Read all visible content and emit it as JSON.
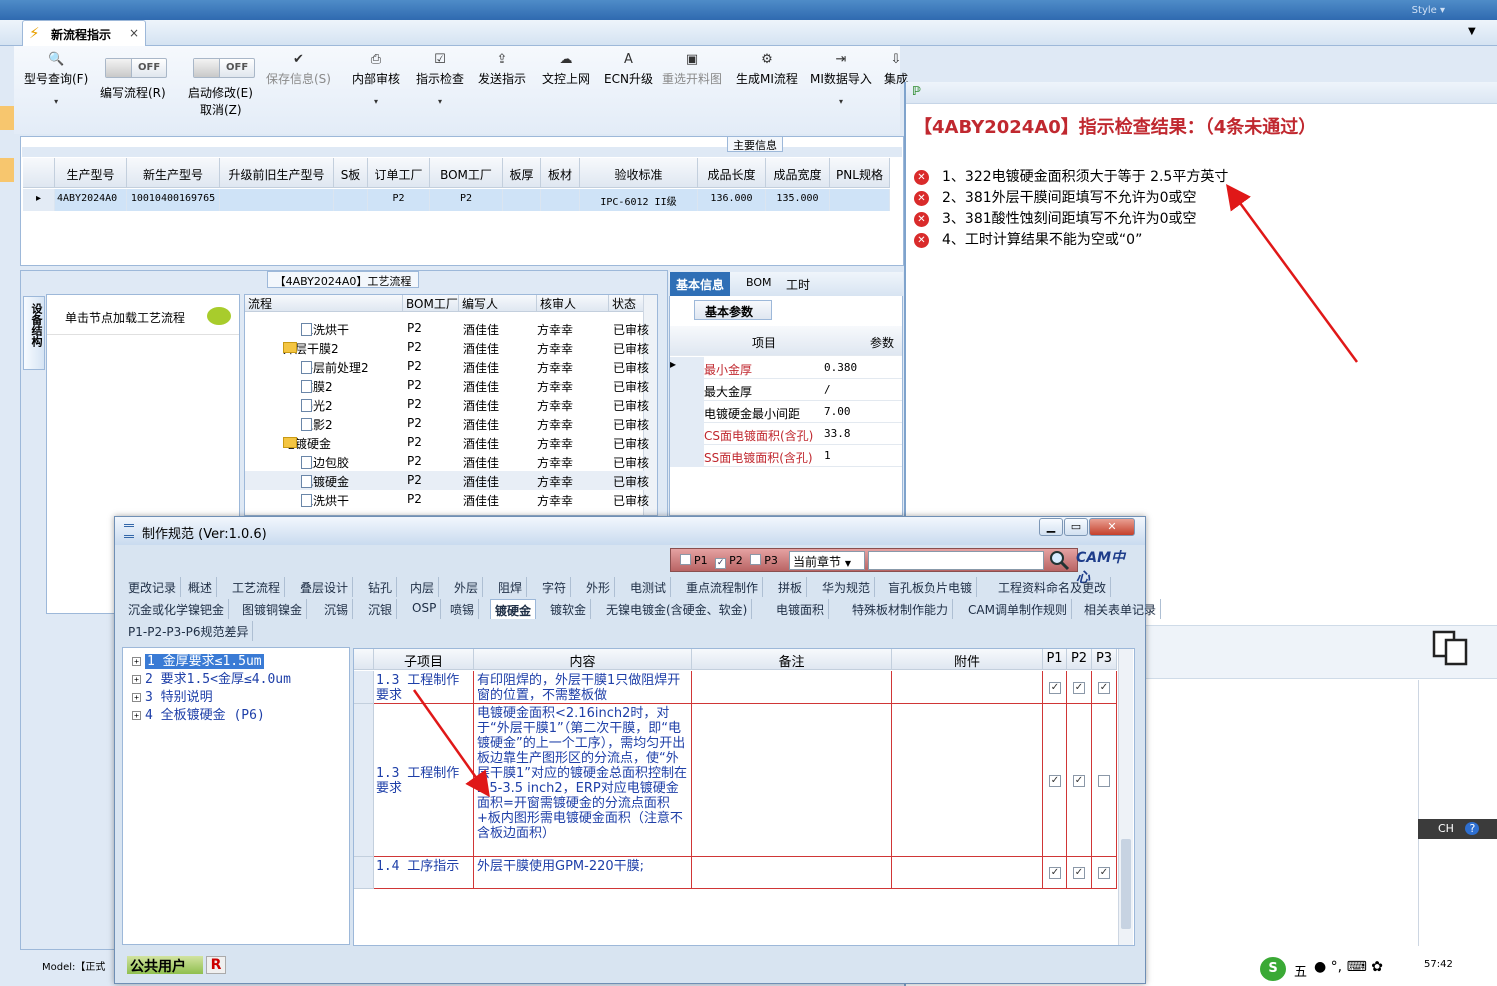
{
  "topbar": {
    "style_label": "Style ▾"
  },
  "tab": {
    "title": "新流程指示",
    "close": "×"
  },
  "ribbon": {
    "items": [
      {
        "label": "型号查询(F)",
        "icon": "search-icon",
        "sym": "🔍"
      },
      {
        "label": "保存信息(S)",
        "icon": "check-icon",
        "sym": "✔",
        "disabled": true
      },
      {
        "label": "内部审核",
        "icon": "printer-icon",
        "sym": "⎙"
      },
      {
        "label": "指示检查",
        "icon": "clipboard-check-icon",
        "sym": "☑"
      },
      {
        "label": "发送指示",
        "icon": "upload-icon",
        "sym": "⇪"
      },
      {
        "label": "文控上网",
        "icon": "cloud-icon",
        "sym": "☁"
      },
      {
        "label": "ECN升级",
        "icon": "ecn-icon",
        "sym": "A"
      },
      {
        "label": "重选开料图",
        "icon": "image-icon",
        "sym": "▣",
        "disabled": true
      },
      {
        "label": "生成MI流程",
        "icon": "gears-icon",
        "sym": "⚙"
      },
      {
        "label": "MI数据导入",
        "icon": "import-icon",
        "sym": "⇥"
      },
      {
        "label": "集成",
        "icon": "download-icon",
        "sym": "⇩"
      }
    ],
    "toggles": [
      {
        "state": "OFF",
        "label": "编写流程(R)"
      },
      {
        "state": "OFF",
        "label": "启动修改(E)",
        "sub": "取消(Z)"
      }
    ]
  },
  "main_info": {
    "title": "主要信息",
    "columns": [
      "生产型号",
      "新生产型号",
      "升级前旧生产型号",
      "S板",
      "订单工厂",
      "BOM工厂",
      "板厚",
      "板材",
      "验收标准",
      "成品长度",
      "成品宽度",
      "PNL规格"
    ],
    "row": [
      "4ABY2024A0",
      "10010400169765",
      "",
      "",
      "P2",
      "P2",
      "",
      "",
      "IPC-6012 II级",
      "136.000",
      "135.000",
      ""
    ]
  },
  "process": {
    "title": "【4ABY2024A0】工艺流程",
    "side_tab": "设备结构",
    "node_hint": "单击节点加载工艺流程",
    "columns": [
      "流程",
      "BOM工厂",
      "编写人",
      "核审人",
      "状态"
    ],
    "rows": [
      {
        "name": "水洗烘干",
        "type": "doc",
        "level": 2,
        "bom": "P2",
        "author": "酒佳佳",
        "reviewer": "方幸幸",
        "status": "已审核"
      },
      {
        "name": "外层干膜2",
        "type": "folder",
        "level": 1,
        "bom": "P2",
        "author": "酒佳佳",
        "reviewer": "方幸幸",
        "status": "已审核"
      },
      {
        "name": "外层前处理2",
        "type": "doc",
        "level": 2,
        "bom": "P2",
        "author": "酒佳佳",
        "reviewer": "方幸幸",
        "status": "已审核"
      },
      {
        "name": "贴膜2",
        "type": "doc",
        "level": 2,
        "bom": "P2",
        "author": "酒佳佳",
        "reviewer": "方幸幸",
        "status": "已审核"
      },
      {
        "name": "曝光2",
        "type": "doc",
        "level": 2,
        "bom": "P2",
        "author": "酒佳佳",
        "reviewer": "方幸幸",
        "status": "已审核"
      },
      {
        "name": "显影2",
        "type": "doc",
        "level": 2,
        "bom": "P2",
        "author": "酒佳佳",
        "reviewer": "方幸幸",
        "status": "已审核"
      },
      {
        "name": "电镀硬金",
        "type": "folder",
        "level": 1,
        "bom": "P2",
        "author": "酒佳佳",
        "reviewer": "方幸幸",
        "status": "已审核"
      },
      {
        "name": "板边包胶",
        "type": "doc",
        "level": 2,
        "bom": "P2",
        "author": "酒佳佳",
        "reviewer": "方幸幸",
        "status": "已审核"
      },
      {
        "name": "电镀硬金",
        "type": "doc",
        "level": 2,
        "bom": "P2",
        "author": "酒佳佳",
        "reviewer": "方幸幸",
        "status": "已审核"
      },
      {
        "name": "水洗烘干",
        "type": "doc",
        "level": 2,
        "bom": "P2",
        "author": "酒佳佳",
        "reviewer": "方幸幸",
        "status": "已审核"
      }
    ]
  },
  "basic": {
    "tabs": [
      "基本信息",
      "BOM",
      "工时"
    ],
    "sub_tab": "基本参数",
    "columns": [
      "项目",
      "参数"
    ],
    "rows": [
      {
        "key": "最小金厚",
        "value": "0.380",
        "red": true
      },
      {
        "key": "最大金厚",
        "value": "/",
        "red": false
      },
      {
        "key": "电镀硬金最小间距",
        "value": "7.00",
        "red": false
      },
      {
        "key": "CS面电镀面积(含孔)",
        "value": "33.8",
        "red": true
      },
      {
        "key": "SS面电镀面积(含孔)",
        "value": "1",
        "red": true
      }
    ]
  },
  "check_result": {
    "title": "【4ABY2024A0】指示检查结果：（4条未通过）",
    "items": [
      "1、322电镀硬金面积须大于等于 2.5平方英寸",
      "2、381外层干膜间距填写不允许为0或空",
      "3、381酸性蚀刻间距填写不允许为0或空",
      "4、工时计算结果不能为空或“0”"
    ]
  },
  "dialog": {
    "title": "制作规范 (Ver:1.0.6)",
    "filters": [
      "P1",
      "P2",
      "P3"
    ],
    "filter_checked": [
      false,
      true,
      false
    ],
    "chapter": "当前章节",
    "logo": "CAM中心",
    "tabs_row1": [
      "更改记录",
      "概述",
      "工艺流程",
      "叠层设计",
      "钻孔",
      "内层",
      "外层",
      "阻焊",
      "字符",
      "外形",
      "电测试",
      "重点流程制作",
      "拼板",
      "华为规范",
      "盲孔板负片电镀",
      "工程资料命名及更改"
    ],
    "tabs_row2": [
      "沉金或化学镍钯金",
      "图镀铜镍金",
      "沉锡",
      "沉银",
      "OSP",
      "喷锡",
      "镀硬金",
      "镀软金",
      "无镍电镀金(含硬金、软金)",
      "电镀面积",
      "特殊板材制作能力",
      "CAM调单制作规则",
      "相关表单记录"
    ],
    "tabs_row3": [
      "P1-P2-P3-P6规范差异"
    ],
    "active_tab": "镀硬金",
    "tree": [
      "1 金厚要求≤1.5um",
      "2 要求1.5<金厚≤4.0um",
      "3 特别说明",
      "4 全板镀硬金 (P6)"
    ],
    "columns": [
      "子项目",
      "内容",
      "备注",
      "附件",
      "P1",
      "P2",
      "P3"
    ],
    "rows": [
      {
        "sub": "1.3 工程制作要求",
        "content": "有印阻焊的，外层干膜1只做阻焊开窗的位置，不需整板做",
        "p": [
          true,
          true,
          true
        ]
      },
      {
        "sub": "1.3 工程制作要求",
        "content": "电镀硬金面积<2.16inch2时，对于“外层干膜1”（第二次干膜，即“电镀硬金”的上一个工序），需均匀开出板边靠生产图形区的分流点，使“外层干膜1”对应的镀硬金总面积控制在2.5-3.5 inch2，ERP对应电镀硬金面积=开窗需镀硬金的分流点面积+板内图形需电镀硬金面积（注意不含板边面积）",
        "p": [
          true,
          true,
          false
        ]
      },
      {
        "sub": "1.4 工序指示",
        "content": "外层干膜使用GPM-220干膜;",
        "p": [
          true,
          true,
          true
        ]
      }
    ],
    "user": "公共用户",
    "user_badge": "R"
  },
  "status": {
    "model": "Model:【正式",
    "clock": "57:42",
    "ime": "五",
    "ch": "CH"
  }
}
